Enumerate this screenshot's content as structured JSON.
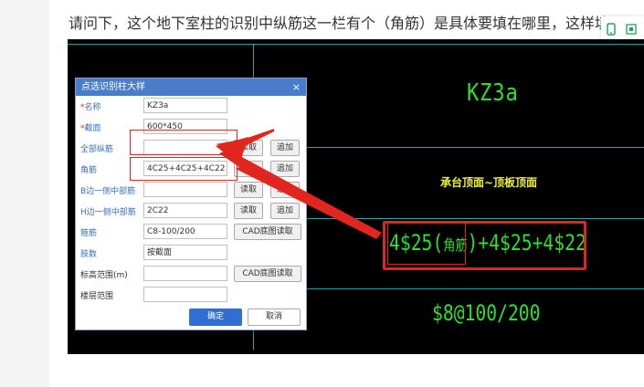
{
  "question": "请问下，这个地下室柱的识别中纵筋这一栏有个（角筋）是具体要填在哪里，这样填对么",
  "cad": {
    "column_name": "KZ3a",
    "elevation_note": "承台顶面~顶板顶面",
    "rebar_prefix": "4$25(",
    "rebar_corner": "角筋",
    "rebar_suffix": ")+4$25+4$22",
    "stirrup": "$8@100/200"
  },
  "dialog": {
    "title": "点选识别柱大样",
    "close": "×",
    "rows": [
      {
        "label": "名称",
        "required": true,
        "value": "KZ3a"
      },
      {
        "label": "截面",
        "required": true,
        "value": "600*450"
      },
      {
        "label": "全部纵筋",
        "value": "",
        "read": "读取",
        "append": "追加"
      },
      {
        "label": "角筋",
        "value": "4C25+4C25+4C22",
        "read": "读取",
        "append": "追加"
      },
      {
        "label": "B边一侧中部筋",
        "value": "",
        "read": "读取",
        "append": "追加"
      },
      {
        "label": "H边一侧中部筋",
        "value": "2C22",
        "read": "读取",
        "append": "追加"
      },
      {
        "label": "箍筋",
        "value": "C8-100/200",
        "cad": "CAD底图读取"
      },
      {
        "label": "肢数",
        "value": "按截面"
      },
      {
        "label": "标高范围(m)",
        "value": "",
        "cad": "CAD底图读取"
      },
      {
        "label": "楼层范围",
        "value": ""
      }
    ],
    "ok": "确定",
    "cancel": "取消"
  },
  "colors": {
    "accent": "#2f6fd3",
    "annotation": "#e0261e",
    "cad_text": "#2ee02e"
  }
}
